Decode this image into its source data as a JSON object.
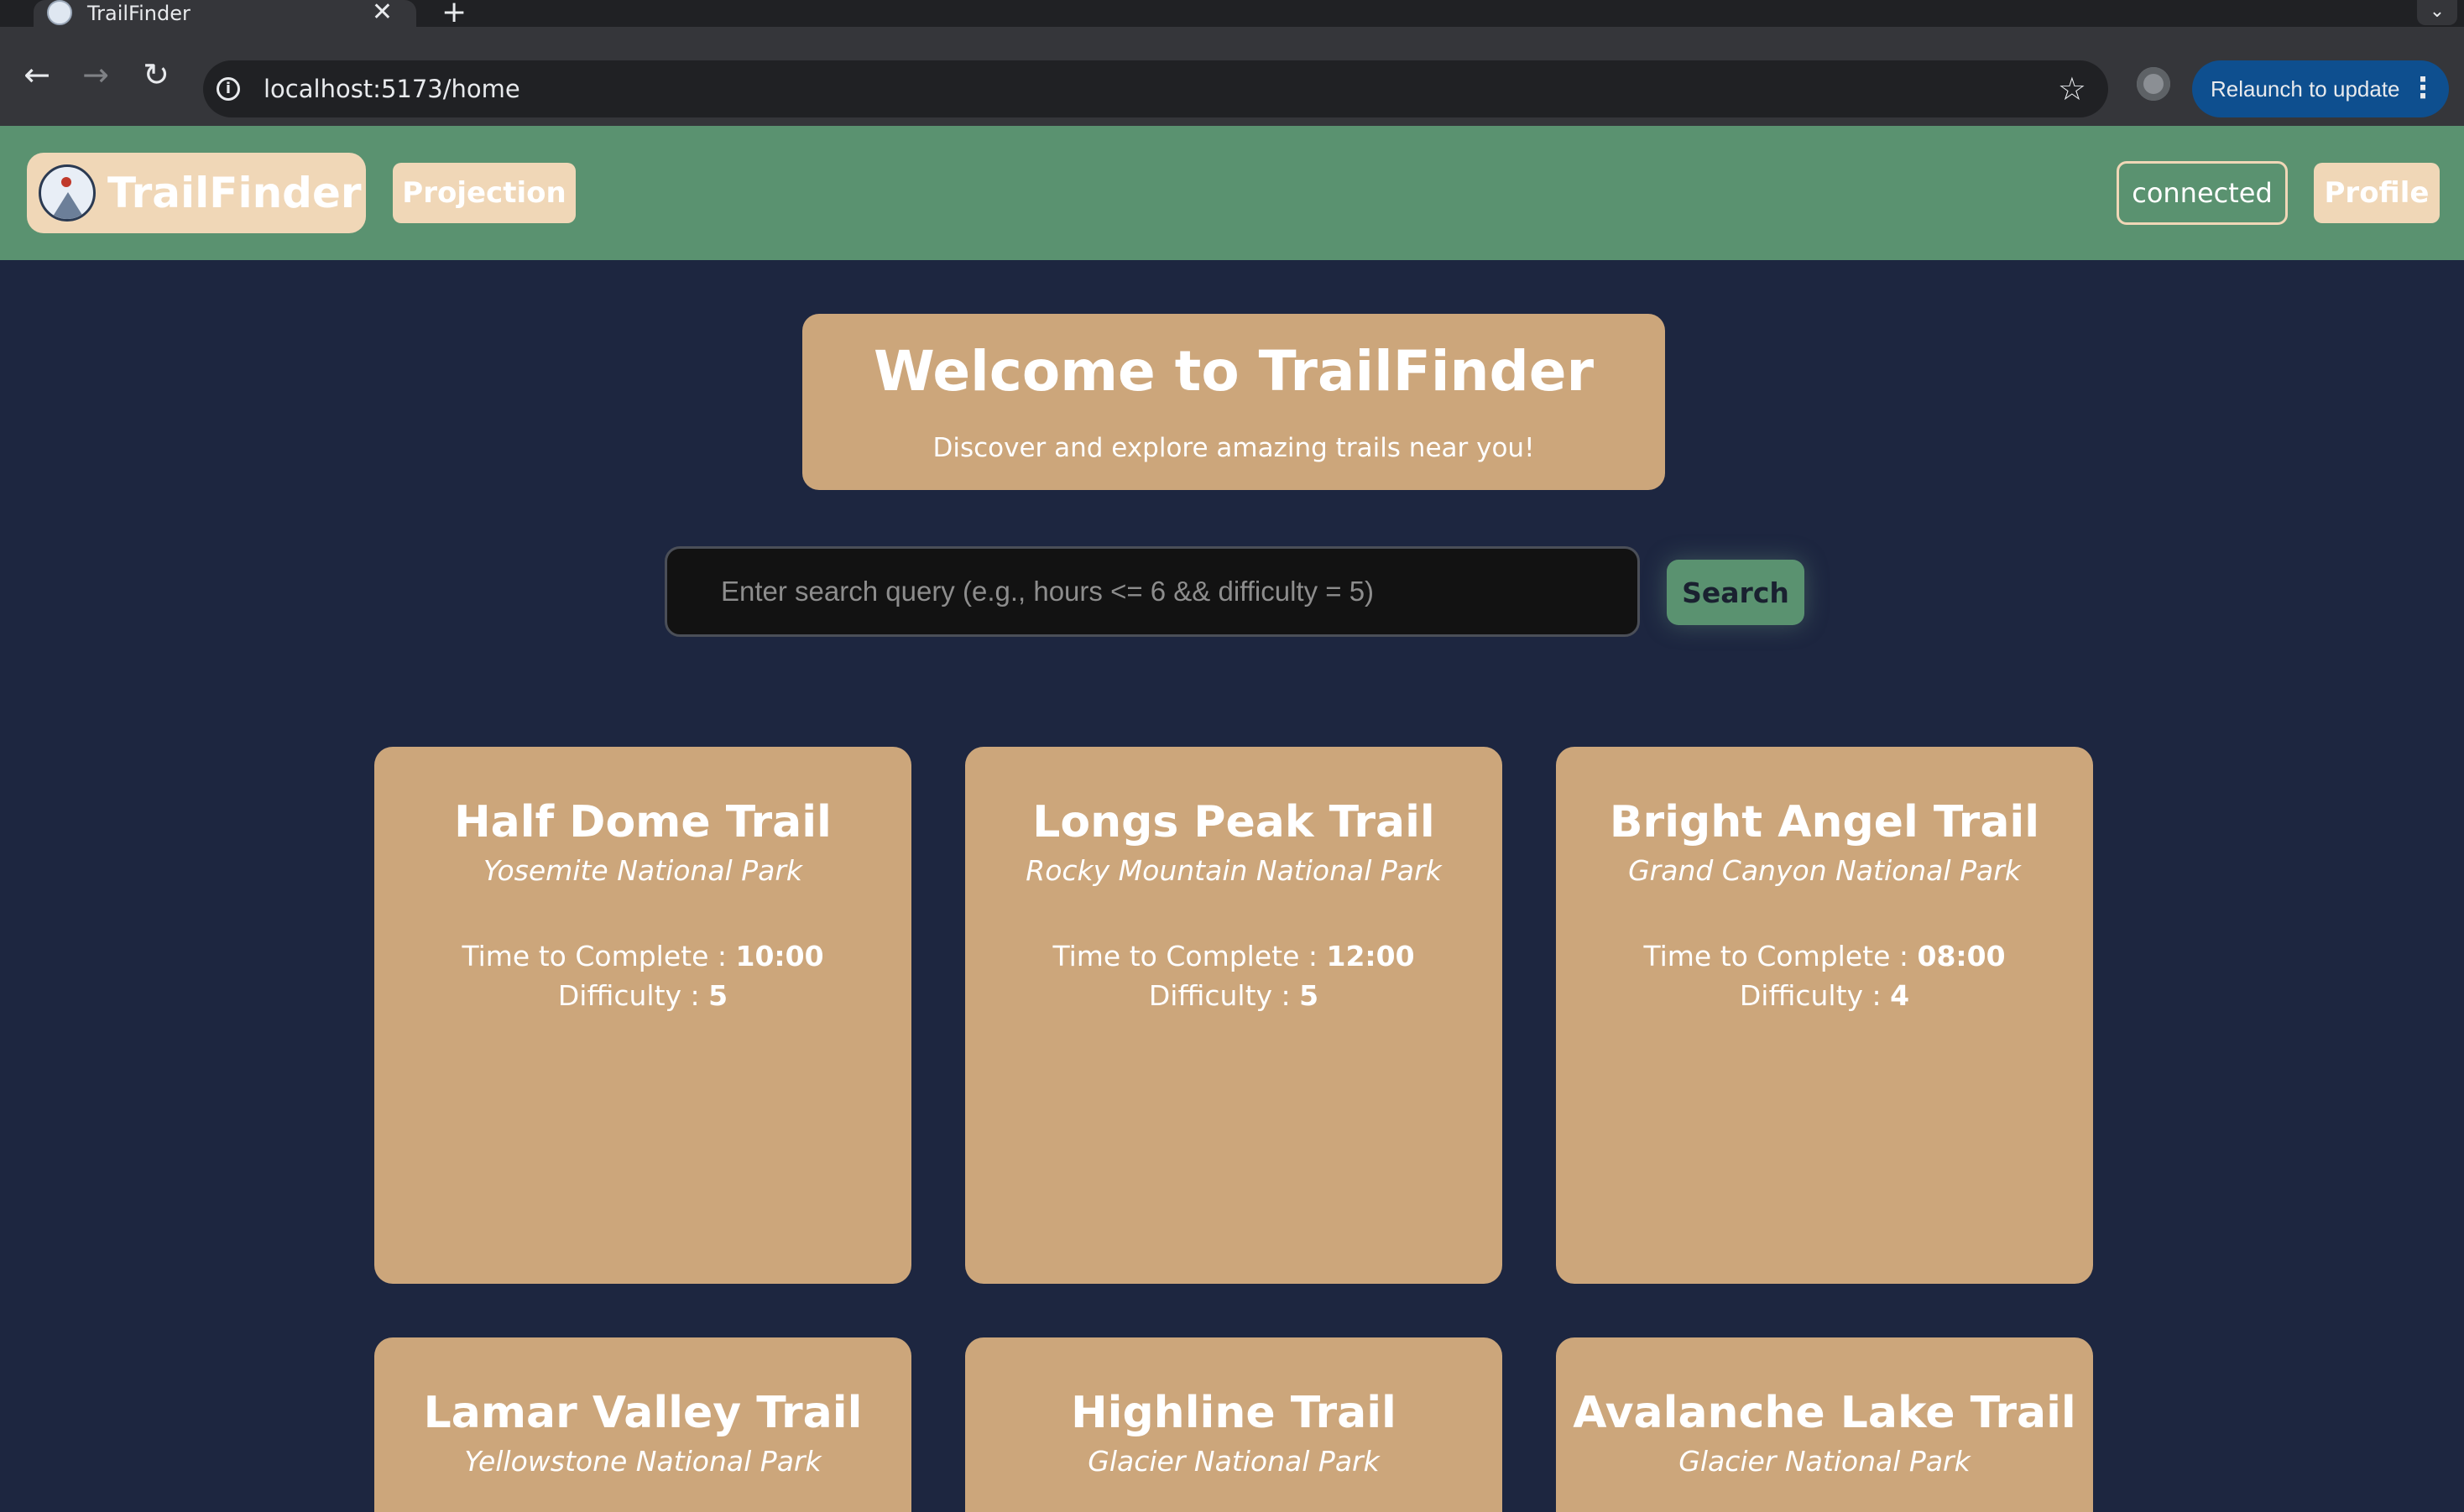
{
  "browser": {
    "tab_title": "TrailFinder",
    "url": "localhost:5173/home",
    "relaunch_label": "Relaunch to update"
  },
  "nav": {
    "brand": "TrailFinder",
    "projection_label": "Projection",
    "connected_label": "connected",
    "profile_label": "Profile"
  },
  "hero": {
    "title": "Welcome to TrailFinder",
    "subtitle": "Discover and explore amazing trails near you!"
  },
  "search": {
    "placeholder": "Enter search query (e.g., hours <= 6 && difficulty = 5)",
    "button_label": "Search"
  },
  "labels": {
    "time_label": "Time to Complete : ",
    "difficulty_label": "Difficulty : "
  },
  "trails": [
    {
      "name": "Half Dome Trail",
      "park": "Yosemite National Park",
      "time": "10:00",
      "difficulty": "5"
    },
    {
      "name": "Longs Peak Trail",
      "park": "Rocky Mountain National Park",
      "time": "12:00",
      "difficulty": "5"
    },
    {
      "name": "Bright Angel Trail",
      "park": "Grand Canyon National Park",
      "time": "08:00",
      "difficulty": "4"
    },
    {
      "name": "Lamar Valley Trail",
      "park": "Yellowstone National Park"
    },
    {
      "name": "Highline Trail",
      "park": "Glacier National Park"
    },
    {
      "name": "Avalanche Lake Trail",
      "park": "Glacier National Park"
    }
  ]
}
